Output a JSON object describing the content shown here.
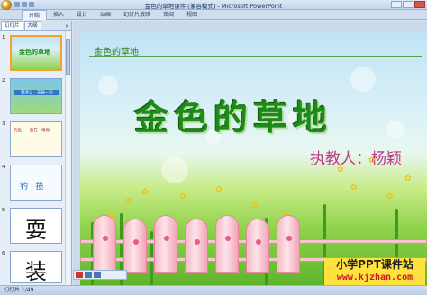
{
  "window": {
    "title": "金色的草地课件 [兼容模式] - Microsoft PowerPoint"
  },
  "ribbon": {
    "tabs": [
      "开始",
      "插入",
      "设计",
      "动画",
      "幻灯片放映",
      "审阅",
      "视图"
    ]
  },
  "panel": {
    "tabs": [
      "幻灯片",
      "大纲"
    ],
    "close_label": "×",
    "thumbnails": [
      {
        "num": "1",
        "text": "金色的草地",
        "selected": true
      },
      {
        "num": "2",
        "text": "我会认 · 去掉一些",
        "selected": false
      },
      {
        "num": "3",
        "text": "钓鱼 · 一直在 · 睡觉",
        "selected": false
      },
      {
        "num": "4",
        "text": "钓 · 揽",
        "selected": false
      },
      {
        "num": "5",
        "text": "耍",
        "selected": false
      },
      {
        "num": "6",
        "text": "装",
        "selected": false
      }
    ]
  },
  "slide": {
    "heading": "金色的草地",
    "title": "金色的草地",
    "teacher": "执教人：杨颖",
    "watermark_line1": "小学PPT课件站",
    "watermark_line2": "www.kjzhan.com"
  },
  "status": {
    "slide_counter": "幻灯片 1/49"
  },
  "colors": {
    "title_green": "#1e8a1a",
    "teacher_pink": "#c0378e",
    "watermark_bg": "#ffe23d"
  }
}
